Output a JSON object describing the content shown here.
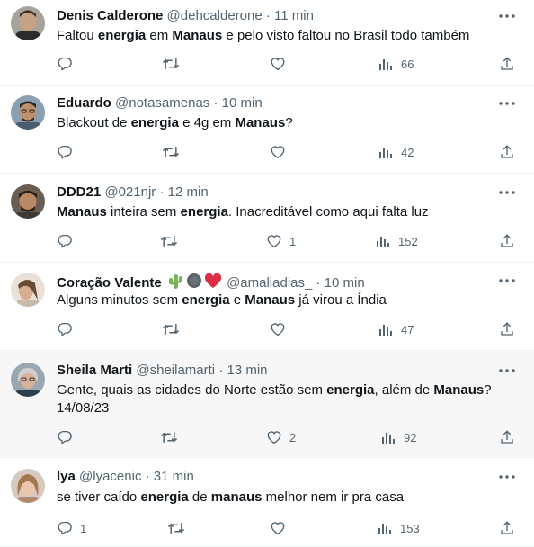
{
  "tweets": [
    {
      "name": "Denis Calderone",
      "handle": "@dehcalderone",
      "separator": "·",
      "time": "11 min",
      "segments": [
        {
          "t": "Faltou ",
          "b": false
        },
        {
          "t": "energia",
          "b": true
        },
        {
          "t": " em ",
          "b": false
        },
        {
          "t": "Manaus",
          "b": true
        },
        {
          "t": " e pelo visto faltou no Brasil todo também",
          "b": false
        }
      ],
      "replies": "",
      "retweets": "",
      "likes": "",
      "views": "66"
    },
    {
      "name": "Eduardo",
      "handle": "@notasamenas",
      "separator": "·",
      "time": "10 min",
      "segments": [
        {
          "t": "Blackout de ",
          "b": false
        },
        {
          "t": "energia",
          "b": true
        },
        {
          "t": " e 4g em ",
          "b": false
        },
        {
          "t": "Manaus",
          "b": true
        },
        {
          "t": "?",
          "b": false
        }
      ],
      "replies": "",
      "retweets": "",
      "likes": "",
      "views": "42"
    },
    {
      "name": "DDD21",
      "handle": "@021njr",
      "separator": "·",
      "time": "12 min",
      "segments": [
        {
          "t": "Manaus",
          "b": true
        },
        {
          "t": " inteira sem ",
          "b": false
        },
        {
          "t": "energia",
          "b": true
        },
        {
          "t": ". Inacreditável como aqui falta luz",
          "b": false
        }
      ],
      "replies": "",
      "retweets": "",
      "likes": "1",
      "views": "152"
    },
    {
      "name": "Coração Valente",
      "name_emojis": [
        "cactus",
        "dark-circle",
        "red-heart"
      ],
      "handle": "@amaliadias_",
      "separator": "·",
      "time": "10 min",
      "segments": [
        {
          "t": "Alguns minutos sem ",
          "b": false
        },
        {
          "t": "energia",
          "b": true
        },
        {
          "t": " e ",
          "b": false
        },
        {
          "t": "Manaus",
          "b": true
        },
        {
          "t": " já virou a Índia",
          "b": false
        }
      ],
      "replies": "",
      "retweets": "",
      "likes": "",
      "views": "47"
    },
    {
      "name": "Sheila Marti",
      "handle": "@sheilamarti",
      "separator": "·",
      "time": "13 min",
      "segments": [
        {
          "t": "Gente, quais as cidades do Norte estão sem ",
          "b": false
        },
        {
          "t": "energia",
          "b": true
        },
        {
          "t": ", além de ",
          "b": false
        },
        {
          "t": "Manaus",
          "b": true
        },
        {
          "t": "?\n14/08/23",
          "b": false
        }
      ],
      "replies": "",
      "retweets": "",
      "likes": "2",
      "views": "92"
    },
    {
      "name": "lya",
      "handle": "@lyacenic",
      "separator": "·",
      "time": "31 min",
      "segments": [
        {
          "t": "se tiver caído ",
          "b": false
        },
        {
          "t": "energia",
          "b": true
        },
        {
          "t": " de ",
          "b": false
        },
        {
          "t": "manaus",
          "b": true
        },
        {
          "t": " melhor nem ir pra casa",
          "b": false
        }
      ],
      "replies": "1",
      "retweets": "",
      "likes": "",
      "views": "153"
    }
  ],
  "icons": {
    "reply": "reply-icon",
    "retweet": "retweet-icon",
    "like": "heart-icon",
    "views": "views-icon",
    "share": "share-icon",
    "more": "more-icon"
  },
  "colors": {
    "text": "#0f1419",
    "secondary": "#536471",
    "highlight_bg": "#f7f7f7",
    "divider": "#eff3f4"
  }
}
